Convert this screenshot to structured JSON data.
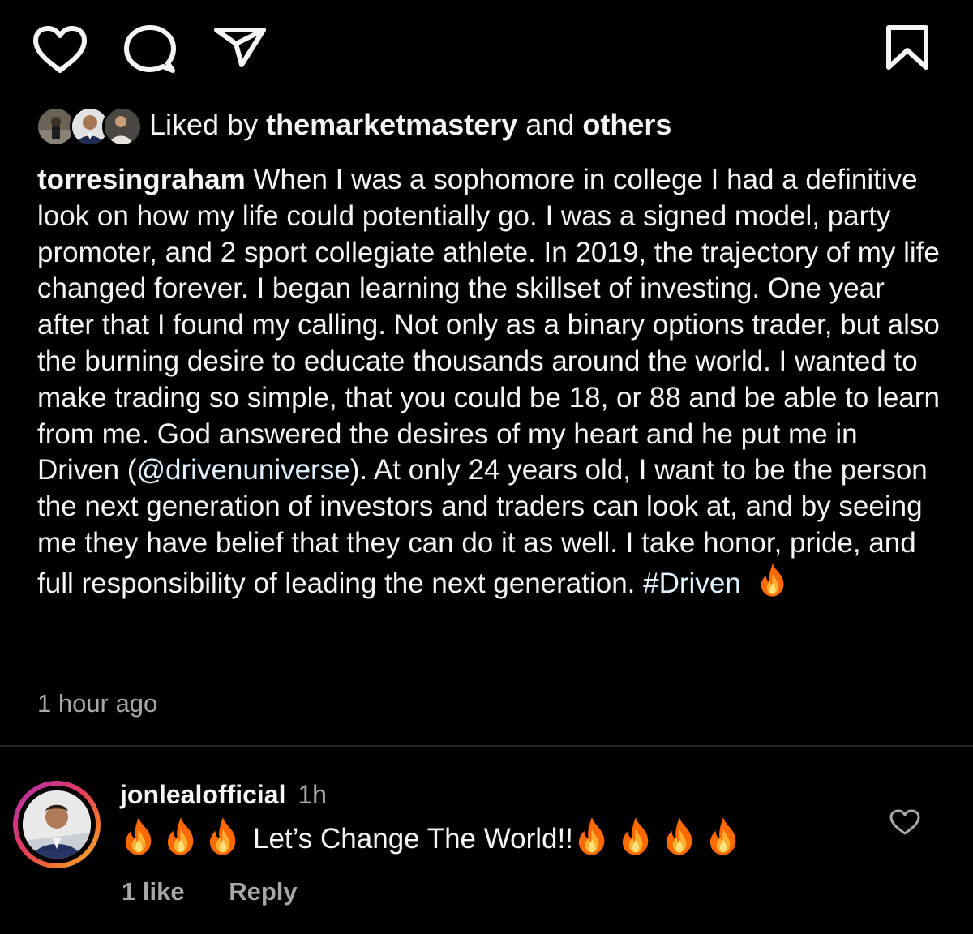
{
  "actions": {
    "like_icon": "heart-outline",
    "comment_icon": "speech-bubble",
    "share_icon": "paper-plane",
    "save_icon": "bookmark-outline"
  },
  "likes": {
    "prefix": "Liked by",
    "user": "themarketmastery",
    "connector": "and",
    "others": "others"
  },
  "post": {
    "username": "torresingraham",
    "caption_part1": "When I was a sophomore in college I had a definitive look on how my life could potentially go. I was a signed model, party promoter, and 2 sport collegiate athlete. In 2019, the trajectory of my life changed forever. I began learning the skillset of investing. One year after that I found my calling. Not only as a binary options trader, but also the burning desire to educate thousands around the world. I wanted to make trading so simple, that you could be 18, or 88 and be able to learn from me. God answered the desires of my heart and he put me in Driven (",
    "mention": "@drivenuniverse",
    "caption_part2": "). At only 24 years old, I want to be the person the next generation of investors and traders can look at, and by seeing me they have belief that they can do it as well. I take honor, pride, and full responsibility of leading the next generation.",
    "hashtag": "#Driven",
    "emoji": "fire",
    "timestamp": "1 hour ago"
  },
  "comment": {
    "username": "jonlealofficial",
    "time": "1h",
    "text": "Let’s Change The World!!",
    "emoji_before_count": 3,
    "emoji_after_count": 4,
    "likes": "1 like",
    "reply_label": "Reply"
  },
  "colors": {
    "background": "#000000",
    "text": "#f5f5f5",
    "muted": "#a8a8a8",
    "link": "#e0f1ff",
    "divider": "#262626"
  }
}
